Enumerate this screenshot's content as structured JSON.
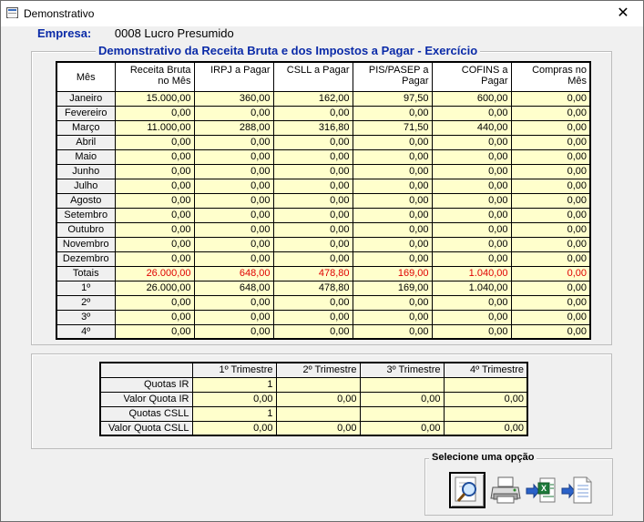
{
  "window": {
    "title": "Demonstrativo",
    "close_glyph": "✕"
  },
  "empresa": {
    "label": "Empresa:",
    "value": "0008  Lucro Presumido"
  },
  "main_group": {
    "title": "Demonstrativo da Receita Bruta e dos Impostos a Pagar - Exercício"
  },
  "main_table": {
    "headers": [
      "Mês",
      "Receita Bruta no Mês",
      "IRPJ a Pagar",
      "CSLL a Pagar",
      "PIS/PASEP a Pagar",
      "COFINS a Pagar",
      "Compras no Mês"
    ],
    "rows": [
      {
        "label": "Janeiro",
        "values": [
          "15.000,00",
          "360,00",
          "162,00",
          "97,50",
          "600,00",
          "0,00"
        ]
      },
      {
        "label": "Fevereiro",
        "values": [
          "0,00",
          "0,00",
          "0,00",
          "0,00",
          "0,00",
          "0,00"
        ]
      },
      {
        "label": "Março",
        "values": [
          "11.000,00",
          "288,00",
          "316,80",
          "71,50",
          "440,00",
          "0,00"
        ]
      },
      {
        "label": "Abril",
        "values": [
          "0,00",
          "0,00",
          "0,00",
          "0,00",
          "0,00",
          "0,00"
        ]
      },
      {
        "label": "Maio",
        "values": [
          "0,00",
          "0,00",
          "0,00",
          "0,00",
          "0,00",
          "0,00"
        ]
      },
      {
        "label": "Junho",
        "values": [
          "0,00",
          "0,00",
          "0,00",
          "0,00",
          "0,00",
          "0,00"
        ]
      },
      {
        "label": "Julho",
        "values": [
          "0,00",
          "0,00",
          "0,00",
          "0,00",
          "0,00",
          "0,00"
        ]
      },
      {
        "label": "Agosto",
        "values": [
          "0,00",
          "0,00",
          "0,00",
          "0,00",
          "0,00",
          "0,00"
        ]
      },
      {
        "label": "Setembro",
        "values": [
          "0,00",
          "0,00",
          "0,00",
          "0,00",
          "0,00",
          "0,00"
        ]
      },
      {
        "label": "Outubro",
        "values": [
          "0,00",
          "0,00",
          "0,00",
          "0,00",
          "0,00",
          "0,00"
        ]
      },
      {
        "label": "Novembro",
        "values": [
          "0,00",
          "0,00",
          "0,00",
          "0,00",
          "0,00",
          "0,00"
        ]
      },
      {
        "label": "Dezembro",
        "values": [
          "0,00",
          "0,00",
          "0,00",
          "0,00",
          "0,00",
          "0,00"
        ]
      },
      {
        "label": "Totais",
        "values": [
          "26.000,00",
          "648,00",
          "478,80",
          "169,00",
          "1.040,00",
          "0,00"
        ]
      },
      {
        "label": "1º",
        "values": [
          "26.000,00",
          "648,00",
          "478,80",
          "169,00",
          "1.040,00",
          "0,00"
        ]
      },
      {
        "label": "2º",
        "values": [
          "0,00",
          "0,00",
          "0,00",
          "0,00",
          "0,00",
          "0,00"
        ]
      },
      {
        "label": "3º",
        "values": [
          "0,00",
          "0,00",
          "0,00",
          "0,00",
          "0,00",
          "0,00"
        ]
      },
      {
        "label": "4º",
        "values": [
          "0,00",
          "0,00",
          "0,00",
          "0,00",
          "0,00",
          "0,00"
        ]
      }
    ],
    "totals_color": "#e00000",
    "cell_bg": "#ffffcc"
  },
  "quarter_table": {
    "headers": [
      "",
      "1º Trimestre",
      "2º Trimestre",
      "3º Trimestre",
      "4º Trimestre"
    ],
    "rows": [
      {
        "label": "Quotas IR",
        "values": [
          "1",
          "",
          "",
          ""
        ]
      },
      {
        "label": "Valor Quota IR",
        "values": [
          "0,00",
          "0,00",
          "0,00",
          "0,00"
        ]
      },
      {
        "label": "Quotas CSLL",
        "values": [
          "1",
          "",
          "",
          ""
        ]
      },
      {
        "label": "Valor Quota CSLL",
        "values": [
          "0,00",
          "0,00",
          "0,00",
          "0,00"
        ]
      }
    ]
  },
  "options": {
    "title": "Selecione uma opção",
    "buttons": [
      {
        "name": "preview",
        "icon": "magnifier-icon",
        "selected": true
      },
      {
        "name": "print",
        "icon": "printer-icon",
        "selected": false
      },
      {
        "name": "export-excel",
        "icon": "excel-export-icon",
        "selected": false
      },
      {
        "name": "export-text",
        "icon": "text-export-icon",
        "selected": false
      }
    ]
  }
}
